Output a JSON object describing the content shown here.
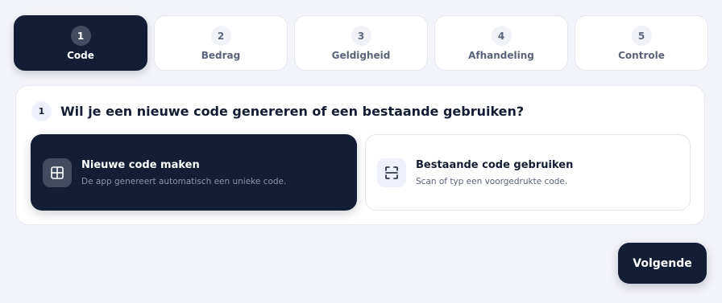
{
  "steps": [
    {
      "number": "1",
      "label": "Code",
      "active": true
    },
    {
      "number": "2",
      "label": "Bedrag",
      "active": false
    },
    {
      "number": "3",
      "label": "Geldigheid",
      "active": false
    },
    {
      "number": "4",
      "label": "Afhandeling",
      "active": false
    },
    {
      "number": "5",
      "label": "Controle",
      "active": false
    }
  ],
  "question": {
    "number": "1",
    "text": "Wil je een nieuwe code genereren of een bestaande gebruiken?"
  },
  "options": [
    {
      "icon": "grid-icon",
      "title": "Nieuwe code maken",
      "description": "De app genereert automatisch een unieke code.",
      "selected": true
    },
    {
      "icon": "scan-icon",
      "title": "Bestaande code gebruiken",
      "description": "Scan of typ een voorgedrukte code.",
      "selected": false
    }
  ],
  "actions": {
    "next_label": "Volgende"
  },
  "colors": {
    "primary": "#131d35",
    "background": "#f3f4f9",
    "surface": "#ffffff"
  }
}
